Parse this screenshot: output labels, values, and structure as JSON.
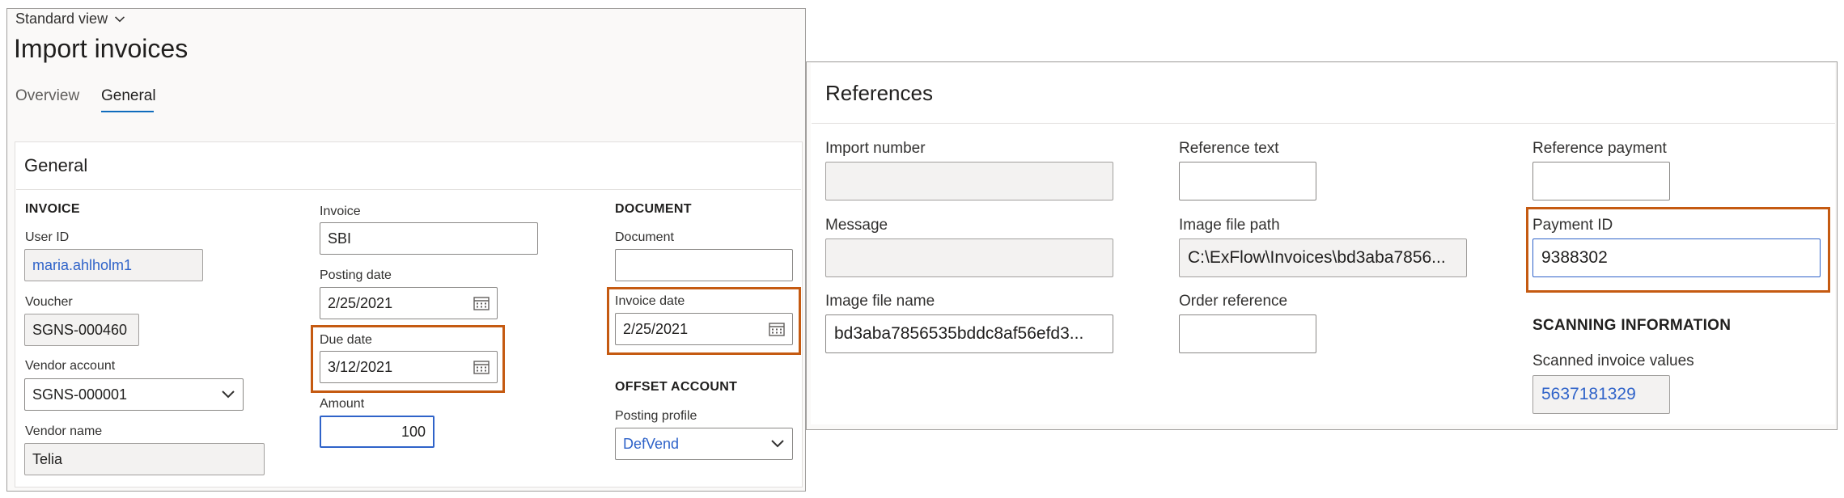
{
  "header": {
    "view_selector": "Standard view",
    "title": "Import invoices",
    "tabs": [
      {
        "label": "Overview",
        "active": false
      },
      {
        "label": "General",
        "active": true
      }
    ]
  },
  "general": {
    "section_title": "General",
    "invoice_group": {
      "heading": "INVOICE",
      "user_id": {
        "label": "User ID",
        "value": "maria.ahlholm1"
      },
      "voucher": {
        "label": "Voucher",
        "value": "SGNS-000460"
      },
      "vendor_account": {
        "label": "Vendor account",
        "value": "SGNS-000001"
      },
      "vendor_name": {
        "label": "Vendor name",
        "value": "Telia"
      }
    },
    "invoice_col2": {
      "invoice": {
        "label": "Invoice",
        "value": "SBI"
      },
      "posting_date": {
        "label": "Posting date",
        "value": "2/25/2021"
      },
      "due_date": {
        "label": "Due date",
        "value": "3/12/2021"
      },
      "amount": {
        "label": "Amount",
        "value": "100"
      }
    },
    "document_group": {
      "heading": "DOCUMENT",
      "document": {
        "label": "Document",
        "value": ""
      },
      "invoice_date": {
        "label": "Invoice date",
        "value": "2/25/2021"
      }
    },
    "offset_group": {
      "heading": "OFFSET ACCOUNT",
      "posting_profile": {
        "label": "Posting profile",
        "value": "DefVend"
      }
    }
  },
  "references": {
    "section_title": "References",
    "import_number": {
      "label": "Import number",
      "value": ""
    },
    "message": {
      "label": "Message",
      "value": ""
    },
    "image_file_name": {
      "label": "Image file name",
      "value": "bd3aba7856535bddc8af56efd3..."
    },
    "reference_text": {
      "label": "Reference text",
      "value": ""
    },
    "image_file_path": {
      "label": "Image file path",
      "value": "C:\\ExFlow\\Invoices\\bd3aba7856..."
    },
    "order_reference": {
      "label": "Order reference",
      "value": ""
    },
    "reference_payment": {
      "label": "Reference payment",
      "value": ""
    },
    "payment_id": {
      "label": "Payment ID",
      "value": "9388302"
    },
    "scanning": {
      "heading": "SCANNING INFORMATION",
      "scanned_invoice_values": {
        "label": "Scanned invoice values",
        "value": "5637181329"
      }
    }
  },
  "colors": {
    "highlight": "#c55a11",
    "link": "#2f63c9",
    "tab_underline": "#0f6cbd"
  },
  "icons": [
    "chevron-down-icon",
    "calendar-icon"
  ]
}
